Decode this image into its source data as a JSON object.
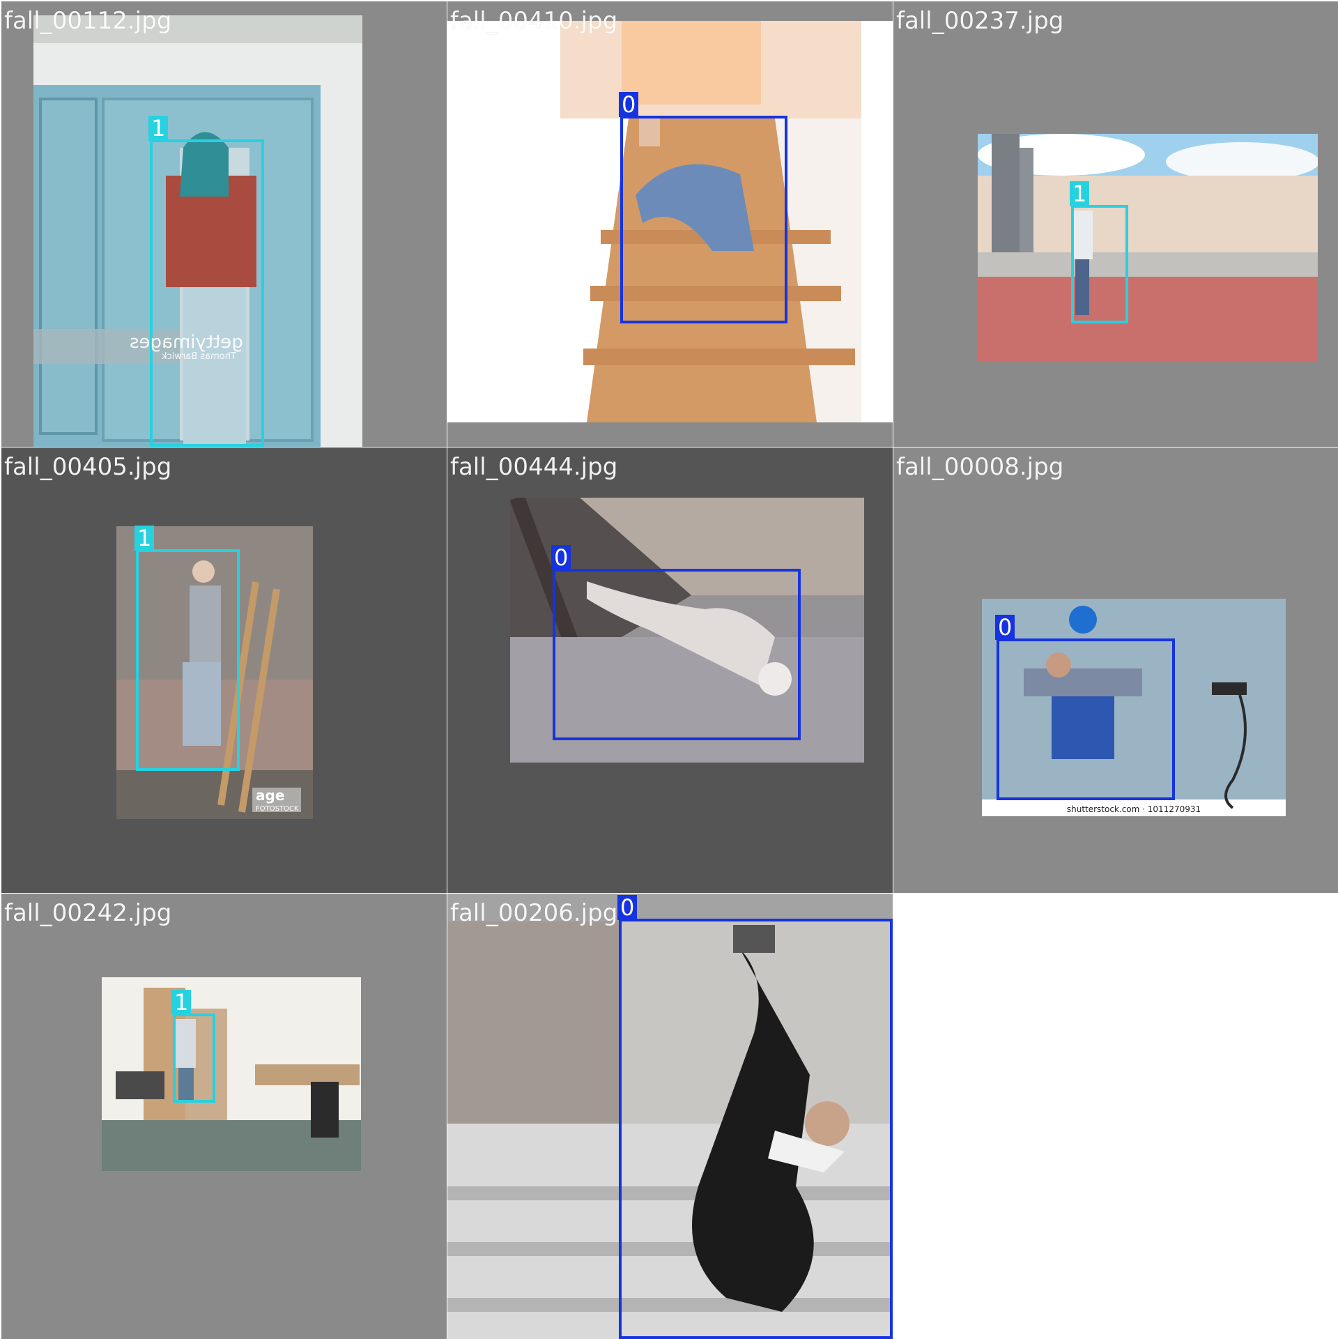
{
  "colors": {
    "class_0": "#1633e0",
    "class_1": "#26d1e0",
    "pad_gray": "#8a8a8a",
    "pad_dark": "#555555"
  },
  "tiles": [
    {
      "file": "fall_00112.jpg",
      "label": "1"
    },
    {
      "file": "fall_00410.jpg",
      "label": "0"
    },
    {
      "file": "fall_00237.jpg",
      "label": "1"
    },
    {
      "file": "fall_00405.jpg",
      "label": "1"
    },
    {
      "file": "fall_00444.jpg",
      "label": "0"
    },
    {
      "file": "fall_00008.jpg",
      "label": "0"
    },
    {
      "file": "fall_00242.jpg",
      "label": "1"
    },
    {
      "file": "fall_00206.jpg",
      "label": "0"
    }
  ],
  "watermarks": {
    "getty": "gettyimages",
    "getty_credit": "Thomas Barwick",
    "age": "age",
    "age_sub": "FOTOSTOCK",
    "shutterstock": "shutterstock.com · 1011270931"
  }
}
